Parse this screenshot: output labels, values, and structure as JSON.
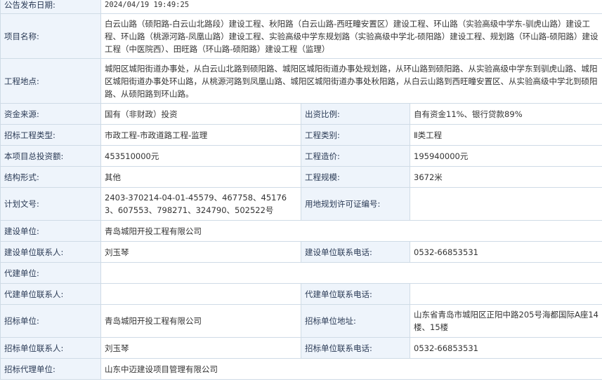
{
  "rows": {
    "publish_date": {
      "label": "公告发布日期:",
      "value": "2024/04/19 19:49:25"
    },
    "project_name": {
      "label": "项目名称:",
      "value": "白云山路（硕阳路-白云山北路段）建设工程、秋阳路（白云山路-西旺疃安置区）建设工程、环山路（实验高级中学东-驯虎山路）建设工程、环山路（桃源河路-凤凰山路）建设工程、实验高级中学东规划路（实验高级中学北-硕阳路）建设工程、规划路（环山路-硕阳路）建设工程（中医院西）、田旺路（环山路-硕阳路）建设工程（监理）"
    },
    "location": {
      "label": "工程地点:",
      "value": "城阳区城阳街道办事处，从白云山北路到硕阳路、城阳区城阳街道办事处规划路，从环山路到硕阳路、从实验高级中学东到驯虎山路、城阳区城阳街道办事处环山路，从桃源河路到凤凰山路、城阳区城阳街道办事处秋阳路，从白云山路到西旺疃安置区、从实验高级中学北到硕阳路、从硕阳路到环山路。"
    },
    "fund_source": {
      "label": "资金来源:",
      "value": "国有（非财政）投资",
      "label2": "出资比例:",
      "value2": "自有资金11%、银行贷款89%"
    },
    "bid_type": {
      "label": "招标工程类型:",
      "value": "市政工程-市政道路工程-监理",
      "label2": "工程类别:",
      "value2": "Ⅱ类工程"
    },
    "investment": {
      "label": "本项目总投资额:",
      "value": "453510000元",
      "label2": "工程造价:",
      "value2": "195940000元"
    },
    "structure": {
      "label": "结构形式:",
      "value": "其他",
      "label2": "工程规模:",
      "value2": "3672米"
    },
    "plan_doc": {
      "label": "计划文号:",
      "value": "2403-370214-04-01-45579、467758、451763、607553、798271、324790、502522号",
      "label2": "用地规划许可证编号:",
      "value2": ""
    },
    "builder": {
      "label": "建设单位:",
      "value": "青岛城阳开投工程有限公司"
    },
    "builder_contact": {
      "label": "建设单位联系人:",
      "value": "刘玉琴",
      "label2": "建设单位联系电话:",
      "value2": "0532-66853531"
    },
    "agent_builder": {
      "label": "代建单位:",
      "value": ""
    },
    "agent_contact": {
      "label": "代建单位联系人:",
      "value": "",
      "label2": "代建单位联系电话:",
      "value2": ""
    },
    "tenderer": {
      "label": "招标单位:",
      "value": "青岛城阳开投工程有限公司",
      "label2": "招标单位地址:",
      "value2": "山东省青岛市城阳区正阳中路205号海都国际A座14楼、15楼"
    },
    "tenderer_contact": {
      "label": "招标单位联系人:",
      "value": "刘玉琴",
      "label2": "招标单位联系电话:",
      "value2": "0532-66853531"
    },
    "tender_agent": {
      "label": "招标代理单位:",
      "value": "山东中迈建设项目管理有限公司"
    }
  }
}
